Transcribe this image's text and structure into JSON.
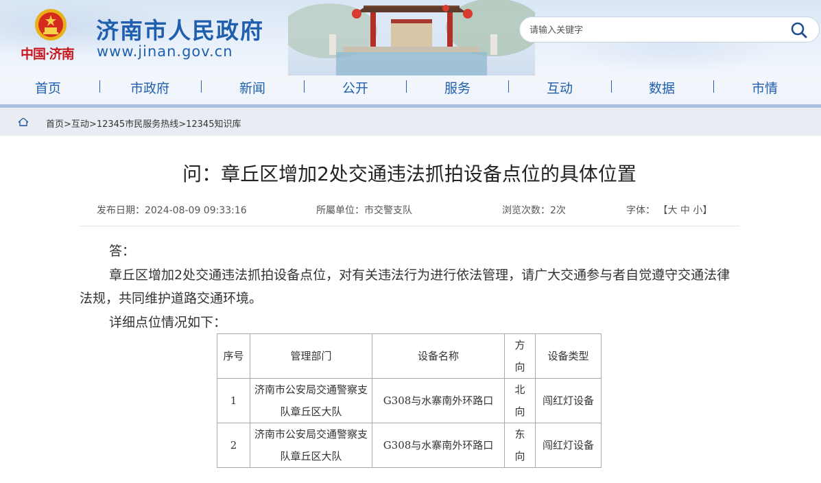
{
  "header": {
    "emblem": "national-emblem",
    "city_logo": "中国·济南",
    "site_title": "济南市人民政府",
    "site_domain": "www.jinan.gov.cn",
    "search": {
      "placeholder": "请输入关键字",
      "value": "",
      "icon": "search-icon"
    },
    "nav": [
      {
        "label": "首页"
      },
      {
        "label": "市政府"
      },
      {
        "label": "新闻"
      },
      {
        "label": "公开"
      },
      {
        "label": "服务"
      },
      {
        "label": "互动"
      },
      {
        "label": "数据"
      },
      {
        "label": "市情"
      }
    ],
    "nav_separator": "|"
  },
  "breadcrumb": {
    "icon": "home-icon",
    "items": [
      "首页",
      "互动",
      "12345市民服务热线",
      "12345知识库"
    ],
    "separator": ">"
  },
  "article": {
    "title": "问：章丘区增加2处交通违法抓拍设备点位的具体位置",
    "meta": {
      "publish_label": "发布日期：",
      "publish_date": "2024-08-09 09:33:16",
      "unit_label": "所屬单位：",
      "unit": "市交警支队",
      "views_label": "浏览次数：",
      "views": "2次",
      "font_label": "字体：",
      "font_open": "【",
      "font_large": "大",
      "font_medium": "中",
      "font_small": "小",
      "font_close": "】"
    },
    "answer_label": "答：",
    "paragraph": "章丘区增加2处交通违法抓拍设备点位，对有关违法行为进行依法管理，请广大交通参与者自觉遵守交通法律法规，共同维护道路交通环境。",
    "detail_intro": "详细点位情况如下：",
    "table": {
      "headers": [
        "序号",
        "管理部门",
        "设备名称",
        "方向",
        "设备类型"
      ],
      "rows": [
        {
          "no": "1",
          "dept": "济南市公安局交通警察支队章丘区大队",
          "name": "G308与水寨南外环路口",
          "direction": "北向",
          "type": "闯红灯设备"
        },
        {
          "no": "2",
          "dept": "济南市公安局交通警察支队章丘区大队",
          "name": "G308与水寨南外环路口",
          "direction": "东向",
          "type": "闯红灯设备"
        }
      ]
    }
  },
  "colors": {
    "brand_blue": "#1f5fae",
    "logo_red": "#c8161d",
    "crumb_bg": "#e9edf3",
    "header_bar": "#a9bfdd"
  }
}
